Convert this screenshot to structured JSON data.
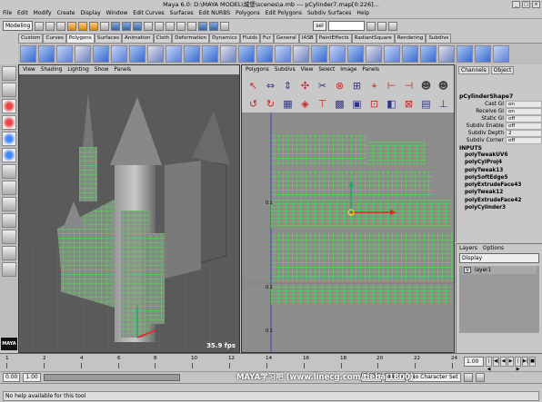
{
  "title": "Maya 6.0: D:\\MAYA MODEL\\城堡\\scenes\\a.mb  ---  pCylinder7.map[0:226]...",
  "menus": [
    "File",
    "Edit",
    "Modify",
    "Create",
    "Display",
    "Window",
    "Edit Curves",
    "Surfaces",
    "Edit NURBS",
    "Polygons",
    "Edit Polygons",
    "Subdiv Surfaces",
    "Help"
  ],
  "status": {
    "mode": "Modeling",
    "sel": "sel"
  },
  "shelf_tabs": [
    "Custom",
    "Curves",
    "Polygons",
    "Surfaces",
    "Animation",
    "Cloth",
    "Deformation",
    "Dynamics",
    "Fluids",
    "Fur",
    "General",
    "IASB",
    "PaintEffects",
    "RadiantSquare",
    "Rendering",
    "Subdivs"
  ],
  "shelf_active": "Polygons",
  "viewport": {
    "menu": [
      "View",
      "Shading",
      "Lighting",
      "Show",
      "Panels"
    ],
    "fps": "35.9 fps"
  },
  "uv_editor": {
    "menu": [
      "Polygons",
      "Subdivs",
      "View",
      "Select",
      "Image",
      "Panels"
    ],
    "tick_labels": [
      "0.1",
      "0.1",
      "0.1"
    ],
    "icons": [
      "move-uv-icon",
      "flip-u-icon",
      "flip-v-icon",
      "rotate-uv-icon",
      "cut-uv-icon",
      "sew-uv-icon",
      "grid-uv-icon",
      "unfold-icon",
      "align-min-u-icon",
      "align-max-u-icon",
      "align-min-v-icon",
      "align-max-v-icon",
      "avatar-icon",
      "avatar-icon",
      "rotate-ccw-icon",
      "rotate-cw-icon",
      "map-uv-icon",
      "texture-icon",
      "checker-icon",
      "display-image-icon",
      "pixel-snap-icon",
      "isolate-icon",
      "uv-lattice-icon",
      "layout-icon"
    ]
  },
  "channels": {
    "tabs": [
      "Channels",
      "Object"
    ],
    "node": "pCylinderShape7",
    "attrs": [
      {
        "k": "Cast GI",
        "v": "on"
      },
      {
        "k": "Receive GI",
        "v": "on"
      },
      {
        "k": "Static GI",
        "v": "off"
      },
      {
        "k": "Subdiv Enable",
        "v": "off"
      },
      {
        "k": "Subdiv Depth",
        "v": "2"
      },
      {
        "k": "Subdiv Corner",
        "v": "off"
      }
    ],
    "inputs_label": "INPUTS",
    "inputs": [
      "polyTweakUV6",
      "polyCylProj4",
      "polyTweak13",
      "polySoftEdge5",
      "polyExtrudeFace43",
      "polyTweak12",
      "polyExtrudeFace42",
      "polyCylinder3"
    ]
  },
  "layers": {
    "tabs": [
      "Layers",
      "Options"
    ],
    "display": "Display",
    "layer_name": "layer1",
    "visibility": "V"
  },
  "timeline": {
    "ticks": [
      "1",
      "2",
      "4",
      "6",
      "8",
      "10",
      "12",
      "14",
      "16",
      "18",
      "20",
      "22",
      "24"
    ],
    "current_frame": "1.00"
  },
  "range": {
    "start": "0.00",
    "start2": "1.00",
    "end": "24.00",
    "end2": "48.00",
    "character": "No Character Set"
  },
  "watermark": "MAYA学习吧  (www.linecg.com/tieba/1800)",
  "help": "No help available for this tool",
  "colors": {
    "wireframe": "#33ff33",
    "manip_y": "#22aa66",
    "manip_x": "#ee2222",
    "manip_center": "#ffee00"
  }
}
